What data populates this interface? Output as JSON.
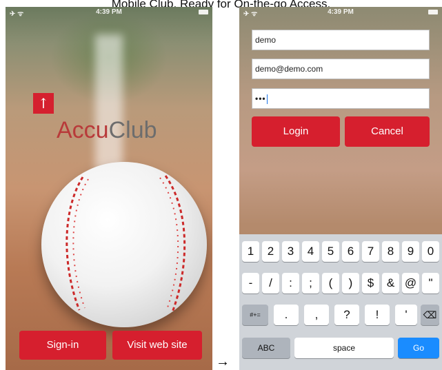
{
  "caption": "Mobile Club. Ready for On-the-go Access.",
  "status_bar": {
    "left": "✈ ᯤ",
    "time": "4:39 PM"
  },
  "left_screen": {
    "logo_glyph": "↑",
    "logo_accu": "Accu",
    "logo_club": "Club",
    "signin_label": "Sign-in",
    "visit_label": "Visit web site"
  },
  "arrow": "→",
  "right_screen": {
    "username_value": "demo",
    "email_value": "demo@demo.com",
    "password_value": "•••",
    "login_label": "Login",
    "cancel_label": "Cancel"
  },
  "keyboard": {
    "row1": [
      "1",
      "2",
      "3",
      "4",
      "5",
      "6",
      "7",
      "8",
      "9",
      "0"
    ],
    "row2": [
      "-",
      "/",
      ":",
      ";",
      "(",
      ")",
      "$",
      "&",
      "@",
      "\""
    ],
    "row3_mode": "#+=",
    "row3": [
      ".",
      ",",
      "?",
      "!",
      "'"
    ],
    "delete": "⌫",
    "abc": "ABC",
    "space": "space",
    "go": "Go"
  },
  "colors": {
    "brand_red": "#d61f2e",
    "go_blue": "#1a8cff"
  }
}
